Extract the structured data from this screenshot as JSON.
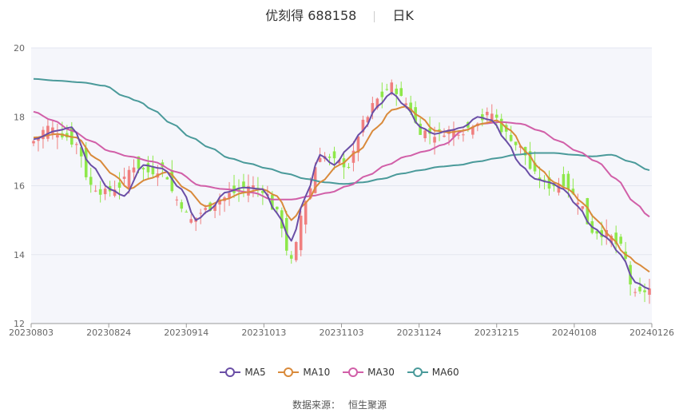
{
  "header": {
    "name": "优刻得 688158",
    "period": "日K"
  },
  "source": {
    "label": "数据来源：",
    "provider": "恒生聚源"
  },
  "colors": {
    "up": "#f07f7f",
    "down": "#8ee84a",
    "ma5": "#6a4ea6",
    "ma10": "#d98a3b",
    "ma30": "#d15fa8",
    "ma60": "#4a9a9a",
    "plotbg": "#f5f6fb",
    "grid": "#e3e6f0"
  },
  "chart_data": {
    "type": "candlestick",
    "yaxis": {
      "min": 12,
      "max": 20,
      "ticks": [
        "12",
        "14",
        "16",
        "18",
        "20"
      ]
    },
    "xaxis_ticks": [
      "20230803",
      "20230824",
      "20230914",
      "20231013",
      "20231103",
      "20231124",
      "20231215",
      "20240108",
      "20240126"
    ],
    "legend": [
      "MA5",
      "MA10",
      "MA30",
      "MA60"
    ],
    "anchors": {
      "close": [
        [
          0,
          17.3
        ],
        [
          3,
          17.7
        ],
        [
          6,
          17.5
        ],
        [
          9,
          17.2
        ],
        [
          12,
          16.0
        ],
        [
          15,
          15.8
        ],
        [
          18,
          16.0
        ],
        [
          21,
          16.6
        ],
        [
          24,
          16.4
        ],
        [
          27,
          16.5
        ],
        [
          30,
          15.6
        ],
        [
          33,
          15.0
        ],
        [
          36,
          15.3
        ],
        [
          39,
          15.6
        ],
        [
          42,
          15.8
        ],
        [
          45,
          16.0
        ],
        [
          48,
          15.9
        ],
        [
          51,
          15.2
        ],
        [
          54,
          13.8
        ],
        [
          57,
          15.6
        ],
        [
          60,
          16.9
        ],
        [
          63,
          16.7
        ],
        [
          66,
          16.6
        ],
        [
          69,
          17.8
        ],
        [
          72,
          18.5
        ],
        [
          75,
          18.9
        ],
        [
          78,
          18.4
        ],
        [
          81,
          17.6
        ],
        [
          84,
          17.5
        ],
        [
          87,
          17.6
        ],
        [
          90,
          17.6
        ],
        [
          93,
          17.9
        ],
        [
          96,
          18.1
        ],
        [
          99,
          17.5
        ],
        [
          102,
          17.1
        ],
        [
          105,
          16.3
        ],
        [
          108,
          16.0
        ],
        [
          111,
          16.1
        ],
        [
          114,
          15.6
        ],
        [
          117,
          14.7
        ],
        [
          120,
          14.6
        ],
        [
          123,
          14.2
        ],
        [
          126,
          12.8
        ],
        [
          129,
          13.0
        ]
      ],
      "ma5": [
        [
          0,
          17.35
        ],
        [
          5,
          17.6
        ],
        [
          8,
          17.7
        ],
        [
          12,
          16.6
        ],
        [
          16,
          15.9
        ],
        [
          19,
          15.7
        ],
        [
          23,
          16.6
        ],
        [
          27,
          16.5
        ],
        [
          31,
          15.9
        ],
        [
          34,
          15.0
        ],
        [
          37,
          15.3
        ],
        [
          40,
          15.8
        ],
        [
          44,
          15.95
        ],
        [
          48,
          15.9
        ],
        [
          51,
          15.2
        ],
        [
          54,
          14.4
        ],
        [
          57,
          15.7
        ],
        [
          60,
          16.9
        ],
        [
          63,
          16.6
        ],
        [
          66,
          17.1
        ],
        [
          69,
          17.6
        ],
        [
          72,
          18.3
        ],
        [
          75,
          18.7
        ],
        [
          78,
          18.3
        ],
        [
          81,
          17.7
        ],
        [
          84,
          17.5
        ],
        [
          87,
          17.6
        ],
        [
          90,
          17.7
        ],
        [
          93,
          18.0
        ],
        [
          96,
          17.9
        ],
        [
          99,
          17.3
        ],
        [
          102,
          16.6
        ],
        [
          105,
          16.2
        ],
        [
          108,
          16.1
        ],
        [
          111,
          15.9
        ],
        [
          114,
          15.4
        ],
        [
          117,
          14.8
        ],
        [
          120,
          14.5
        ],
        [
          123,
          14.0
        ],
        [
          126,
          13.2
        ],
        [
          129,
          13.0
        ]
      ],
      "ma10": [
        [
          0,
          17.4
        ],
        [
          5,
          17.5
        ],
        [
          9,
          17.4
        ],
        [
          13,
          16.8
        ],
        [
          17,
          16.3
        ],
        [
          20,
          15.9
        ],
        [
          24,
          16.2
        ],
        [
          28,
          16.4
        ],
        [
          32,
          15.9
        ],
        [
          36,
          15.4
        ],
        [
          40,
          15.6
        ],
        [
          44,
          15.8
        ],
        [
          48,
          15.9
        ],
        [
          51,
          15.7
        ],
        [
          54,
          15.0
        ],
        [
          57,
          15.5
        ],
        [
          60,
          16.1
        ],
        [
          64,
          16.6
        ],
        [
          68,
          17.0
        ],
        [
          72,
          17.7
        ],
        [
          75,
          18.2
        ],
        [
          78,
          18.3
        ],
        [
          81,
          18.0
        ],
        [
          84,
          17.6
        ],
        [
          87,
          17.55
        ],
        [
          90,
          17.6
        ],
        [
          94,
          17.8
        ],
        [
          97,
          17.9
        ],
        [
          100,
          17.6
        ],
        [
          103,
          17.0
        ],
        [
          106,
          16.5
        ],
        [
          109,
          16.1
        ],
        [
          112,
          15.9
        ],
        [
          115,
          15.5
        ],
        [
          118,
          15.0
        ],
        [
          121,
          14.5
        ],
        [
          124,
          14.0
        ],
        [
          127,
          13.7
        ],
        [
          129,
          13.5
        ]
      ],
      "ma30": [
        [
          0,
          18.15
        ],
        [
          4,
          17.9
        ],
        [
          8,
          17.6
        ],
        [
          12,
          17.3
        ],
        [
          16,
          17.0
        ],
        [
          20,
          16.85
        ],
        [
          25,
          16.7
        ],
        [
          30,
          16.4
        ],
        [
          35,
          16.0
        ],
        [
          40,
          15.9
        ],
        [
          46,
          15.8
        ],
        [
          50,
          15.6
        ],
        [
          54,
          15.6
        ],
        [
          58,
          15.7
        ],
        [
          62,
          15.8
        ],
        [
          66,
          16.0
        ],
        [
          70,
          16.3
        ],
        [
          74,
          16.6
        ],
        [
          78,
          16.85
        ],
        [
          82,
          17.0
        ],
        [
          86,
          17.2
        ],
        [
          90,
          17.6
        ],
        [
          94,
          17.8
        ],
        [
          98,
          17.85
        ],
        [
          102,
          17.8
        ],
        [
          106,
          17.6
        ],
        [
          110,
          17.3
        ],
        [
          114,
          17.0
        ],
        [
          118,
          16.7
        ],
        [
          122,
          16.2
        ],
        [
          126,
          15.5
        ],
        [
          129,
          15.1
        ]
      ],
      "ma60": [
        [
          0,
          19.1
        ],
        [
          5,
          19.05
        ],
        [
          10,
          19.0
        ],
        [
          15,
          18.9
        ],
        [
          19,
          18.6
        ],
        [
          22,
          18.45
        ],
        [
          25,
          18.2
        ],
        [
          29,
          17.8
        ],
        [
          33,
          17.4
        ],
        [
          37,
          17.1
        ],
        [
          41,
          16.8
        ],
        [
          45,
          16.65
        ],
        [
          49,
          16.5
        ],
        [
          53,
          16.35
        ],
        [
          57,
          16.2
        ],
        [
          61,
          16.1
        ],
        [
          65,
          16.05
        ],
        [
          69,
          16.1
        ],
        [
          73,
          16.2
        ],
        [
          77,
          16.35
        ],
        [
          81,
          16.45
        ],
        [
          85,
          16.55
        ],
        [
          89,
          16.6
        ],
        [
          93,
          16.7
        ],
        [
          97,
          16.8
        ],
        [
          101,
          16.9
        ],
        [
          105,
          16.95
        ],
        [
          109,
          16.95
        ],
        [
          113,
          16.9
        ],
        [
          117,
          16.85
        ],
        [
          121,
          16.9
        ],
        [
          125,
          16.7
        ],
        [
          129,
          16.45
        ]
      ]
    }
  }
}
